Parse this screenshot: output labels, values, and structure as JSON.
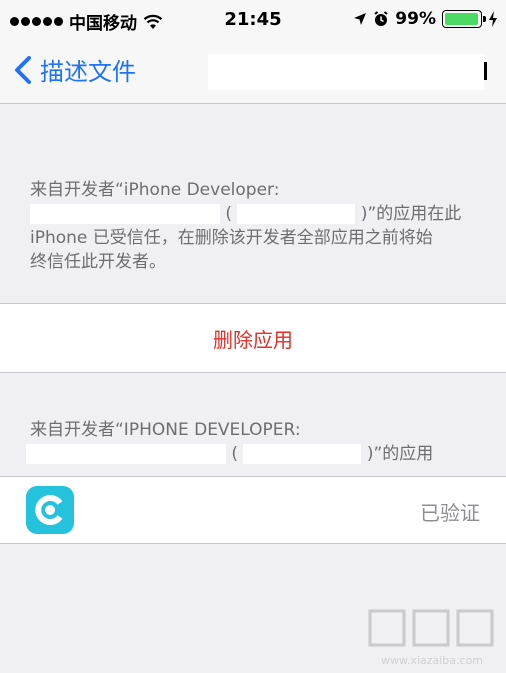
{
  "status_bar": {
    "carrier": "中国移动",
    "time": "21:45",
    "battery": "99%",
    "battery_level": 0.99,
    "icons": [
      "signal-dots-icon",
      "wifi-icon",
      "location-arrow-icon",
      "alarm-icon",
      "battery-icon",
      "charging-icon"
    ]
  },
  "nav": {
    "back_label": "描述文件"
  },
  "section1": {
    "line1": "来自开发者“iPhone Developer:",
    "line2_open": "(",
    "line2_close": ")”的应用在此",
    "line3": "iPhone 已受信任，在删除该开发者全部应用之前将始",
    "line4": "终信任此开发者。"
  },
  "delete_button": {
    "label": "删除应用"
  },
  "section2": {
    "line1": "来自开发者“IPHONE DEVELOPER:",
    "line2_open": "(",
    "line2_close": ")”的应用"
  },
  "app_row": {
    "status": "已验证",
    "icon": "app-icon-c"
  },
  "watermark": {
    "text": "www.xiazaiba.com",
    "logo": "下载吧"
  },
  "colors": {
    "accent": "#1f74f5",
    "destructive": "#e0302a",
    "battery": "#4cd964",
    "app_icon": "#24c2dc"
  }
}
